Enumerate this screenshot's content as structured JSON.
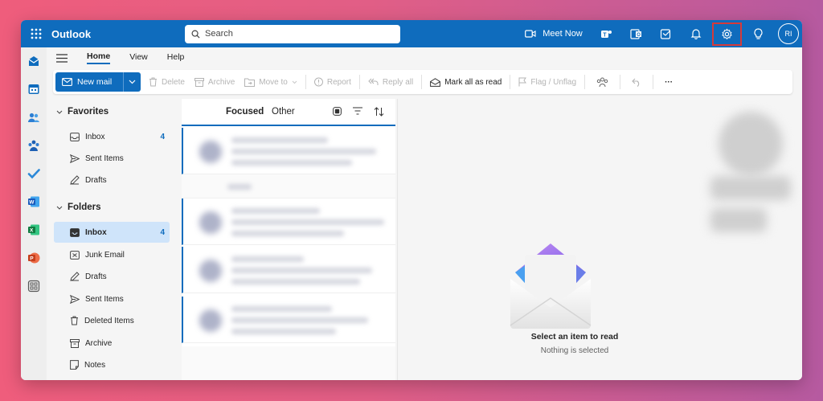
{
  "app": {
    "title": "Outlook"
  },
  "search": {
    "placeholder": "Search"
  },
  "topbar": {
    "meet_now": "Meet Now",
    "avatar_initials": "RI"
  },
  "menu": {
    "tabs": [
      "Home",
      "View",
      "Help"
    ]
  },
  "ribbon": {
    "new_mail": "New mail",
    "delete": "Delete",
    "archive": "Archive",
    "move_to": "Move to",
    "report": "Report",
    "reply_all": "Reply all",
    "mark_all_read": "Mark all as read",
    "flag_unflag": "Flag / Unflag",
    "more": "···"
  },
  "favorites": {
    "heading": "Favorites",
    "items": [
      {
        "label": "Inbox",
        "count": "4"
      },
      {
        "label": "Sent Items",
        "count": ""
      },
      {
        "label": "Drafts",
        "count": ""
      }
    ]
  },
  "folders": {
    "heading": "Folders",
    "items": [
      {
        "label": "Inbox",
        "count": "4"
      },
      {
        "label": "Junk Email",
        "count": ""
      },
      {
        "label": "Drafts",
        "count": ""
      },
      {
        "label": "Sent Items",
        "count": ""
      },
      {
        "label": "Deleted Items",
        "count": ""
      },
      {
        "label": "Archive",
        "count": ""
      },
      {
        "label": "Notes",
        "count": ""
      }
    ]
  },
  "message_list": {
    "tab_focused": "Focused",
    "tab_other": "Other"
  },
  "reading_pane": {
    "title": "Select an item to read",
    "subtitle": "Nothing is selected"
  },
  "colors": {
    "brand": "#0f6cbd",
    "highlight": "#d63a3a"
  }
}
